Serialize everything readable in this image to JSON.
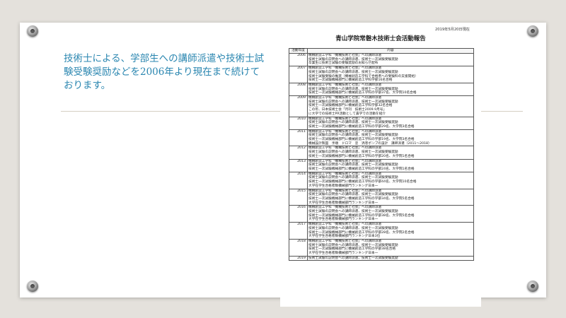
{
  "slide": {
    "body_text": "技術士による、学部生への講師派遣や技術士試験受験奨励などを2006年より現在まで続けております。"
  },
  "document": {
    "date": "2019年5月20日現在",
    "title": "青山学院常磐木技術士会活動報告",
    "table": {
      "headers": [
        "活動年度",
        "内容"
      ],
      "rows": [
        {
          "year": "2006",
          "items": [
            "機械創造工学科「機械技術と社会」への講師派遣",
            "技術士試験の説明会への講師派遣、技術士一次試験受験奨励",
            "卒業生に技術士試験の受験奨励のお知らせ配布"
          ]
        },
        {
          "year": "2007",
          "items": [
            "機械創造工学科「機械技術と社会」への講師派遣",
            "技術士試験の説明会への講師派遣、技術士一次試験受験奨励",
            "技術士試験受験の推奨（機械創造工学科で合格者への受験料の支援開始）",
            "技術士一次試験機械部門に機械創造工学科学部16名合格"
          ]
        },
        {
          "year": "2008",
          "items": [
            "機械創造工学科「機械技術と社会」への講師派遣",
            "技術士試験の説明会への講師派遣、技術士一次試験受験奨励",
            "技術士一次試験機械部門に機械創造工学科の学部37名、大学院10名合格"
          ]
        },
        {
          "year": "2009",
          "items": [
            "機械創造工学科「機械技術と社会」への講師派遣",
            "技術士試験の説明会への講師派遣、技術士一次試験受験奨励",
            "技術士一次試験機械部門に機械創造工学科学部32名合格",
            "この年、日本技術士会「月刊　技術士2009.9月号」",
            "に大学での技術士PR活動として貴学での活動を紹介"
          ]
        },
        {
          "year": "2010",
          "items": [
            "機械創造工学科「機械技術と社会」への講師派遣",
            "技術士試験の説明会への講師派遣、技術士一次試験受験奨励",
            "技術士一次試験機械部門に機械創造工学科の学部29名、大学院3名合格"
          ]
        },
        {
          "year": "2011",
          "items": [
            "機械創造工学科「機械技術と社会」への講師派遣",
            "技術士試験の説明会への講師派遣、技術士一次試験受験奨励",
            "技術士一次試験機械部門に機械創造工学科の学部19名、大学院3名合格",
            "機械設計製図　手順　ドロマ　塗　渦巻ポンプの設計　講師派遣（2011～2018）"
          ]
        },
        {
          "year": "2012",
          "items": [
            "機械創造工学科「機械技術と社会」への講師派遣",
            "技術士試験の説明会への講師派遣、技術士一次試験受験奨励",
            "技術士一次試験機械部門に機械創造工学科の学部20名、大学院1名合格"
          ]
        },
        {
          "year": "2013",
          "items": [
            "機械創造工学科「機械技術と社会」への講師派遣",
            "技術士試験の説明会への講師派遣、技術士一次試験受験奨励",
            "技術士一次試験機械部門に機械創造工学科の学部24名、大学院1名合格"
          ]
        },
        {
          "year": "2014",
          "items": [
            "機械創造工学科「機械技術と社会」への講師派遣",
            "技術士試験の説明会への講師派遣、技術士一次試験受験奨励",
            "技術士一次試験機械部門に機械創造工学科の学部44名、大学院10名合格",
            "大学在学生合格者数機械部門ランキング日本一"
          ]
        },
        {
          "year": "2015",
          "items": [
            "機械創造工学科「機械技術と社会」への講師派遣",
            "技術士試験の説明会への講師派遣、技術士一次試験受験奨励",
            "技術士一次試験機械部門に機械創造工学科の学部34名、大学院5名合格",
            "大学在学生合格者数機械部門ランキング日本一"
          ]
        },
        {
          "year": "2016",
          "items": [
            "機械創造工学科「機械技術と社会」への講師派遣",
            "技術士試験の説明会への講師派遣、技術士一次試験受験奨励",
            "技術士一次試験機械部門に機械創造工学科の学部38名、大学院5名合格",
            "大学在学生合格者数機械部門ランキング日本一"
          ]
        },
        {
          "year": "2017",
          "items": [
            "機械創造工学科「機械技術と社会」への講師派遣",
            "技術士試験の説明会への講師派遣、技術士一次試験受験奨励",
            "技術士一次試験機械部門に機械創造工学科の学部28名、大学院2名合格",
            "大学在学生合格者数機械部門ランキング日本3位"
          ]
        },
        {
          "year": "2018",
          "items": [
            "機械創造工学科「機械技術と社会」への講師派遣",
            "技術士試験の説明会への講師派遣、技術士一次試験受験奨励",
            "技術士一次試験機械部門に機械創造工学科の学部38名合格",
            "大学在学生合格者数機械部門ランキング日本一"
          ]
        },
        {
          "year": "2019",
          "items": [
            "技術士試験の説明会への講師派遣、技術士一次試験受験奨励"
          ]
        }
      ]
    }
  }
}
